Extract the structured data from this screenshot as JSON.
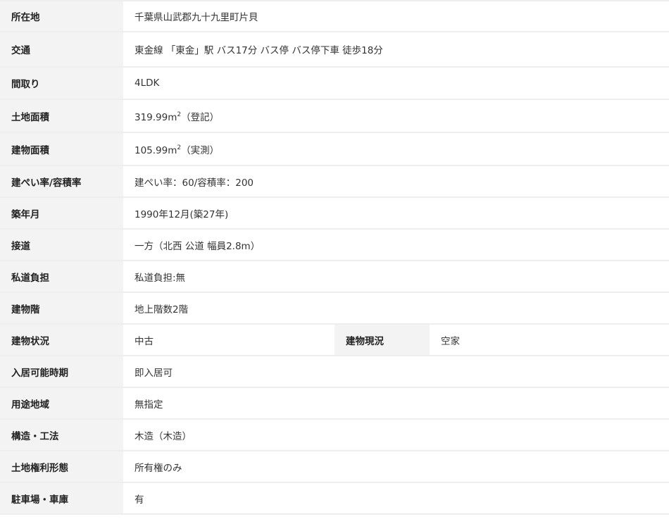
{
  "rows": [
    {
      "label": "所在地",
      "value": "千葉県山武郡九十九里町片貝"
    },
    {
      "label": "交通",
      "value": "東金線 「東金」駅 バス17分 バス停 バス停下車 徒歩18分"
    },
    {
      "label": "間取り",
      "value": "4LDK"
    },
    {
      "label": "土地面積",
      "value_main": "319.99m",
      "value_sup": "2",
      "value_suffix": "（登記）"
    },
    {
      "label": "建物面積",
      "value_main": "105.99m",
      "value_sup": "2",
      "value_suffix": "（実測）"
    },
    {
      "label": "建ぺい率/容積率",
      "value": "建ぺい率：60/容積率：200"
    },
    {
      "label": "築年月",
      "value": "1990年12月(築27年)"
    },
    {
      "label": "接道",
      "value": "一方（北西 公道 幅員2.8m）"
    },
    {
      "label": "私道負担",
      "value": "私道負担:無"
    },
    {
      "label": "建物階",
      "value": "地上階数2階"
    },
    {
      "label": "建物状況",
      "value": "中古",
      "label2": "建物現況",
      "value2": "空家"
    },
    {
      "label": "入居可能時期",
      "value": "即入居可"
    },
    {
      "label": "用途地域",
      "value": "無指定"
    },
    {
      "label": "構造・工法",
      "value": "木造（木造）"
    },
    {
      "label": "土地権利形態",
      "value": "所有権のみ"
    },
    {
      "label": "駐車場・車庫",
      "value": "有"
    }
  ]
}
